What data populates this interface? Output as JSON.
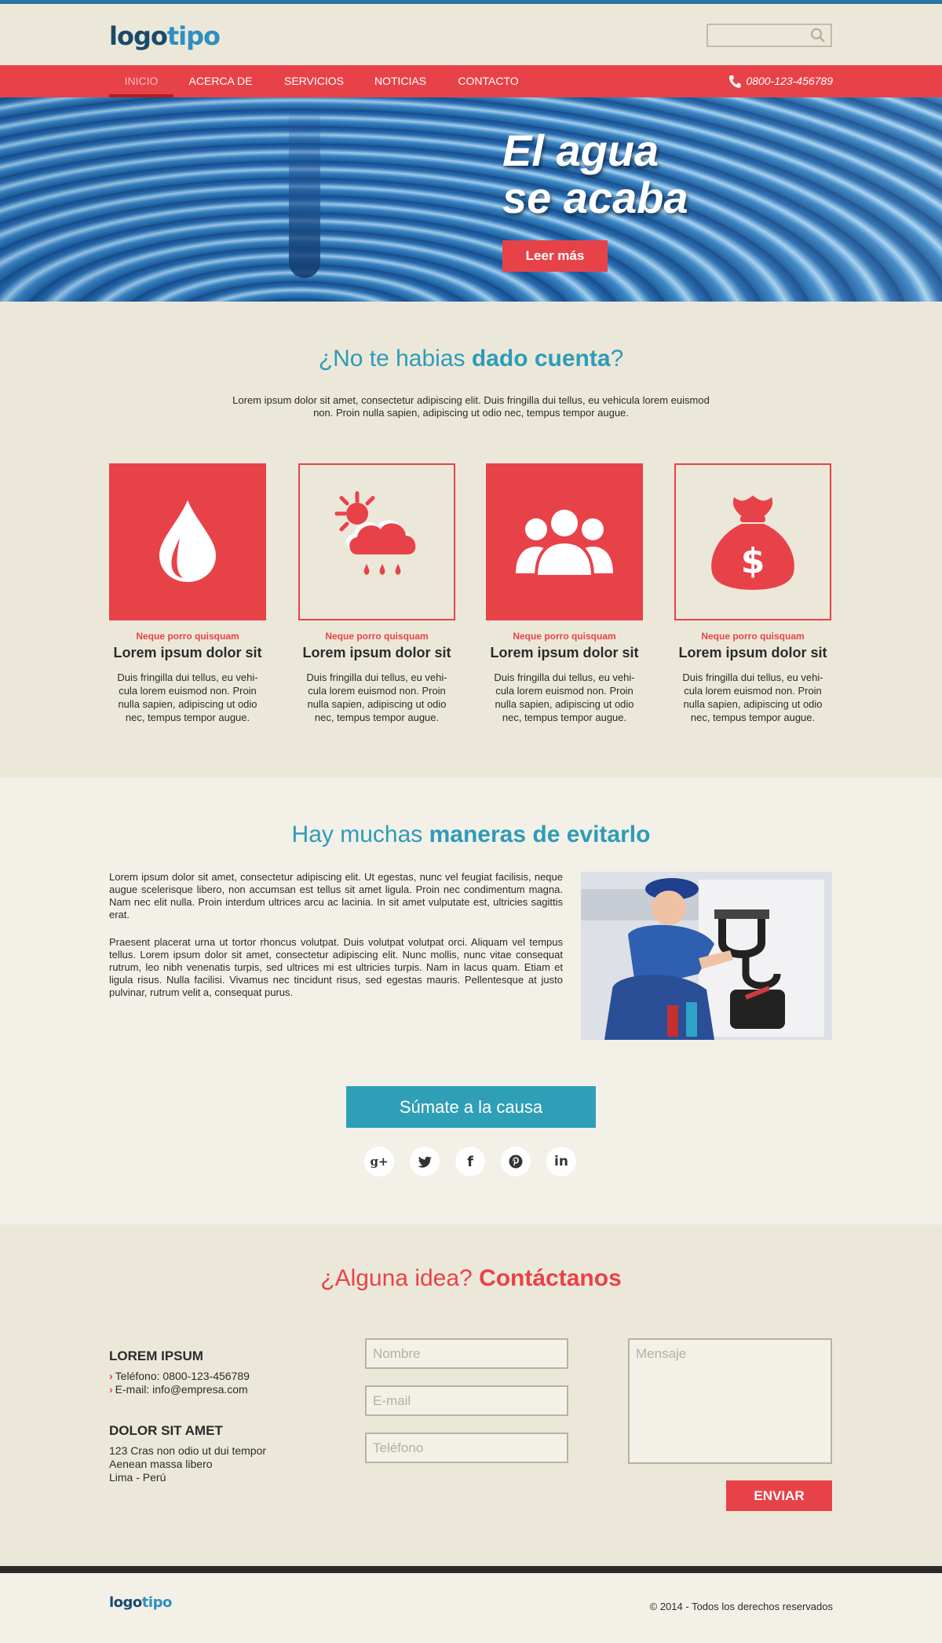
{
  "header": {
    "logo_part1": "logo",
    "logo_part2": "tipo",
    "search_placeholder": ""
  },
  "nav": {
    "items": [
      "INICIO",
      "ACERCA DE",
      "SERVICIOS",
      "NOTICIAS",
      "CONTACTO"
    ],
    "active_index": 0,
    "phone": "0800-123-456789"
  },
  "hero": {
    "title_line1": "El agua",
    "title_line2": "se acaba",
    "button": "Leer más"
  },
  "section1": {
    "title_light": "¿No te habias ",
    "title_bold": "dado cuenta",
    "title_end": "?",
    "intro": "Lorem ipsum dolor sit amet, consectetur adipiscing elit. Duis fringilla dui tellus, eu vehicula lorem euismod non. Proin nulla sapien, adipiscing ut odio nec, tempus tempor augue.",
    "cards": [
      {
        "icon": "water-drop-icon",
        "kicker": "Neque porro quisquam",
        "title": "Lorem ipsum dolor sit",
        "text": "Duis fringilla dui tellus, eu vehi-cula lorem euismod non. Proin nulla sapien, adipiscing ut odio nec, tempus tempor augue."
      },
      {
        "icon": "sun-rain-cloud-icon",
        "kicker": "Neque porro quisquam",
        "title": "Lorem ipsum dolor sit",
        "text": "Duis fringilla dui tellus, eu vehi-cula lorem euismod non. Proin nulla sapien, adipiscing ut odio nec, tempus tempor augue."
      },
      {
        "icon": "people-group-icon",
        "kicker": "Neque porro quisquam",
        "title": "Lorem ipsum dolor sit",
        "text": "Duis fringilla dui tellus, eu vehi-cula lorem euismod non. Proin nulla sapien, adipiscing ut odio nec, tempus tempor augue."
      },
      {
        "icon": "money-bag-icon",
        "kicker": "Neque porro quisquam",
        "title": "Lorem ipsum dolor sit",
        "text": "Duis fringilla dui tellus, eu vehi-cula lorem euismod non. Proin nulla sapien, adipiscing ut odio nec, tempus tempor augue."
      }
    ]
  },
  "section2": {
    "title_light": "Hay muchas ",
    "title_bold": "maneras de evitarlo",
    "para1": "Lorem ipsum dolor sit amet, consectetur adipiscing elit. Ut egestas, nunc vel feugiat facilisis, neque augue scelerisque libero, non accumsan est tellus sit amet ligula. Proin nec condimentum magna. Nam nec elit nulla. Proin interdum ultrices arcu ac lacinia. In sit amet vulputate est, ultricies sagittis erat.",
    "para2": "Praesent placerat urna ut tortor rhoncus volutpat. Duis volutpat volutpat orci. Aliquam vel tempus tellus. Lorem ipsum dolor sit amet, consectetur adipiscing elit. Nunc mollis, nunc vitae consequat rutrum, leo nibh venenatis turpis, sed ultrices mi est ultricies turpis. Nam in lacus quam. Etiam et ligula risus. Nulla facilisi. Vivamus nec tincidunt risus, sed egestas mauris. Pellentesque at justo pulvinar, rutrum velit a, consequat purus.",
    "cta": "Súmate a la causa",
    "social": [
      {
        "name": "google-plus-icon",
        "glyph": "g+"
      },
      {
        "name": "twitter-icon",
        "glyph": ""
      },
      {
        "name": "facebook-icon",
        "glyph": "f"
      },
      {
        "name": "pinterest-icon",
        "glyph": "p"
      },
      {
        "name": "linkedin-icon",
        "glyph": "in"
      }
    ]
  },
  "section3": {
    "title_light": "¿Alguna idea? ",
    "title_bold": "Contáctanos",
    "block1_title": "LOREM IPSUM",
    "phone_line": "Teléfono: 0800-123-456789",
    "email_line": "E-mail: info@empresa.com",
    "block2_title": "DOLOR SIT AMET",
    "address1": "123 Cras non odio ut dui tempor",
    "address2": "Aenean massa libero",
    "address3": "Lima - Perú",
    "name_placeholder": "Nombre",
    "email_placeholder": "E-mail",
    "phone_placeholder": "Teléfono",
    "message_placeholder": "Mensaje",
    "send": "ENVIAR"
  },
  "footer": {
    "logo_part1": "logo",
    "logo_part2": "tipo",
    "copyright": "© 2014 - Todos los derechos reservados"
  },
  "colors": {
    "accent_red": "#e84249",
    "accent_blue": "#2e9bb8",
    "beige": "#ece8d9"
  }
}
